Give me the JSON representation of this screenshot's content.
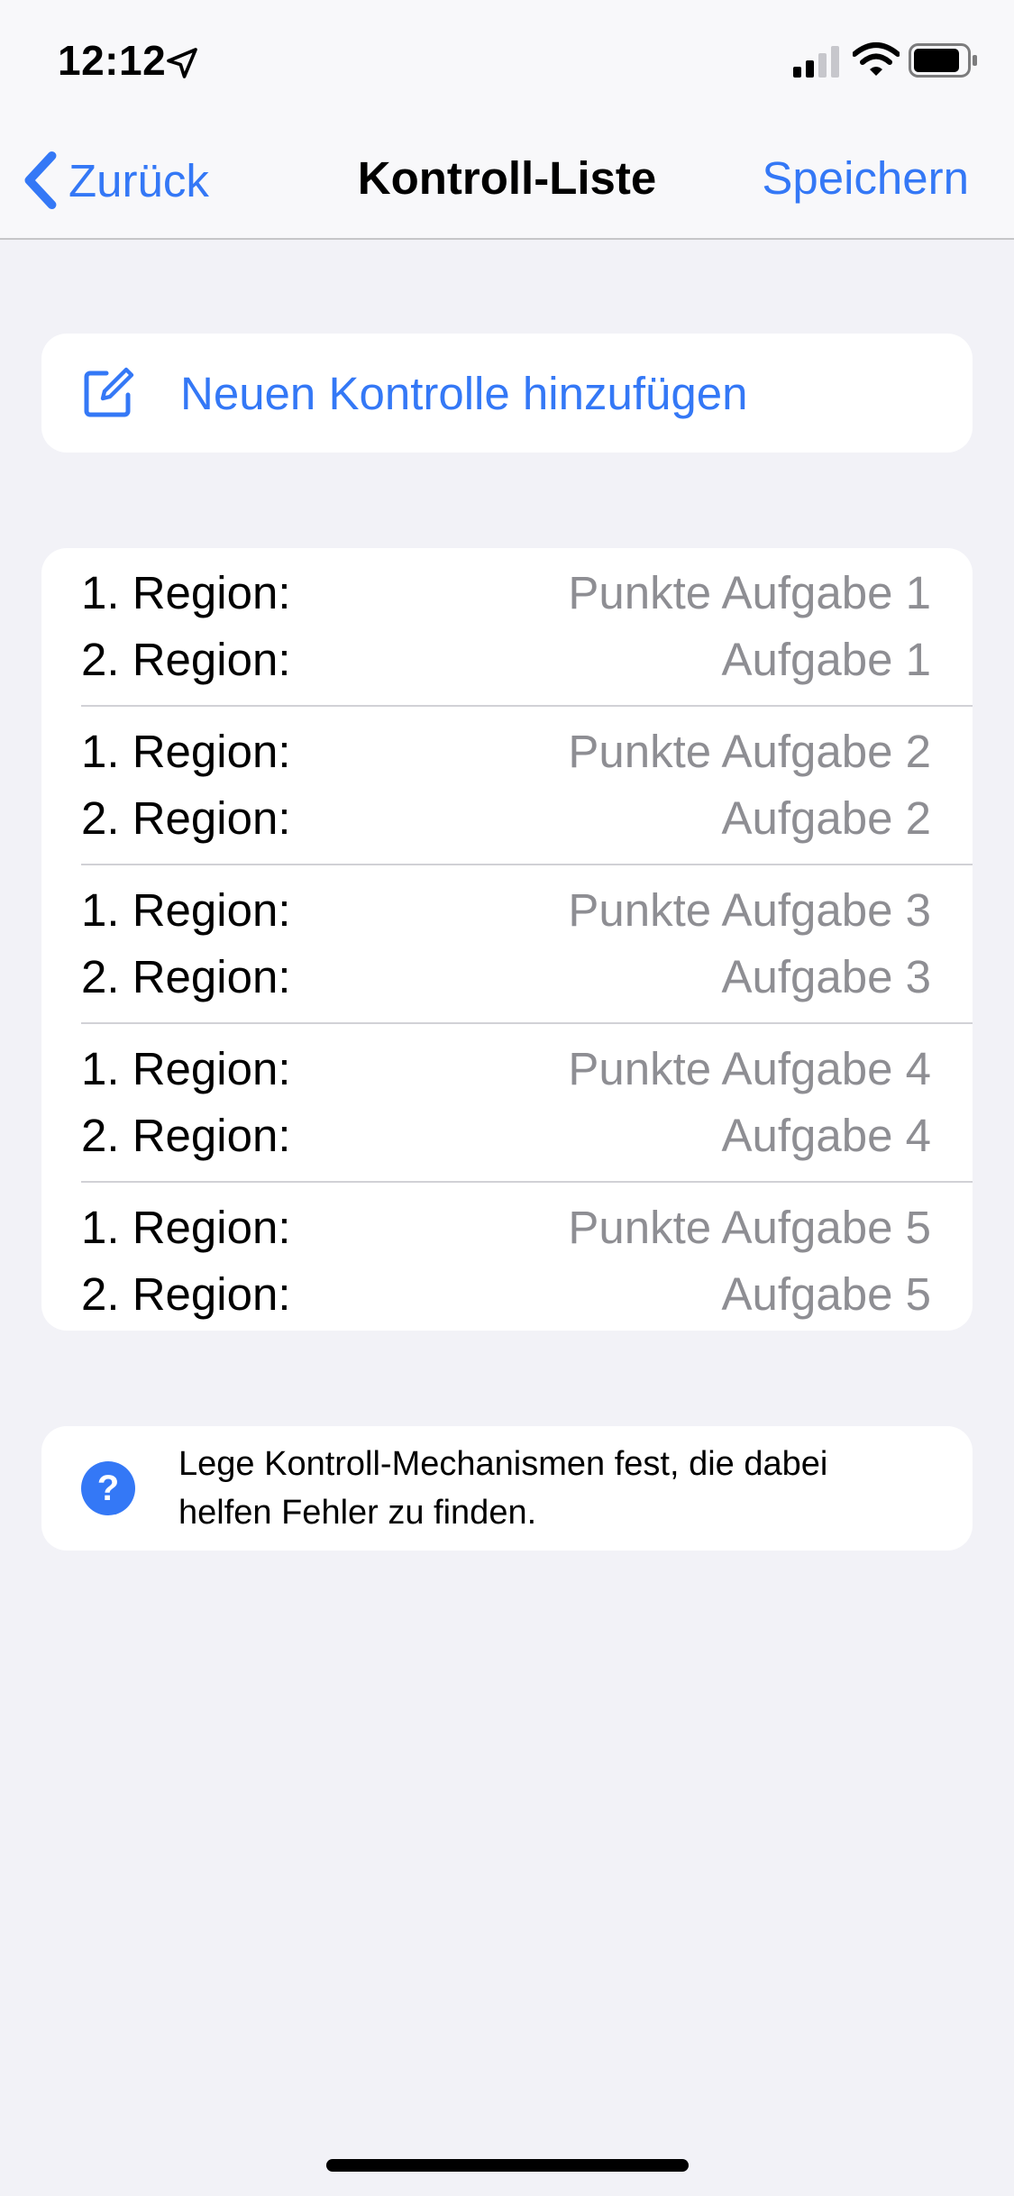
{
  "status_bar": {
    "time": "12:12"
  },
  "nav": {
    "back_label": "Zurück",
    "title": "Kontroll-Liste",
    "save_label": "Speichern"
  },
  "add_control": {
    "label": "Neuen Kontrolle hinzufügen"
  },
  "controls": [
    {
      "region1_label": "1. Region:",
      "region1_value": "Punkte Aufgabe 1",
      "region2_label": "2. Region:",
      "region2_value": "Aufgabe 1"
    },
    {
      "region1_label": "1. Region:",
      "region1_value": "Punkte Aufgabe 2",
      "region2_label": "2. Region:",
      "region2_value": "Aufgabe 2"
    },
    {
      "region1_label": "1. Region:",
      "region1_value": "Punkte Aufgabe 3",
      "region2_label": "2. Region:",
      "region2_value": "Aufgabe 3"
    },
    {
      "region1_label": "1. Region:",
      "region1_value": "Punkte Aufgabe 4",
      "region2_label": "2. Region:",
      "region2_value": "Aufgabe 4"
    },
    {
      "region1_label": "1. Region:",
      "region1_value": "Punkte Aufgabe 5",
      "region2_label": "2. Region:",
      "region2_value": "Aufgabe 5"
    }
  ],
  "help": {
    "icon_glyph": "?",
    "text": "Lege Kontroll-Mechanismen fest, die dabei helfen Fehler zu finden."
  },
  "colors": {
    "accent": "#3478f6",
    "background": "#f2f2f7",
    "secondary_text": "#8e8e93"
  }
}
